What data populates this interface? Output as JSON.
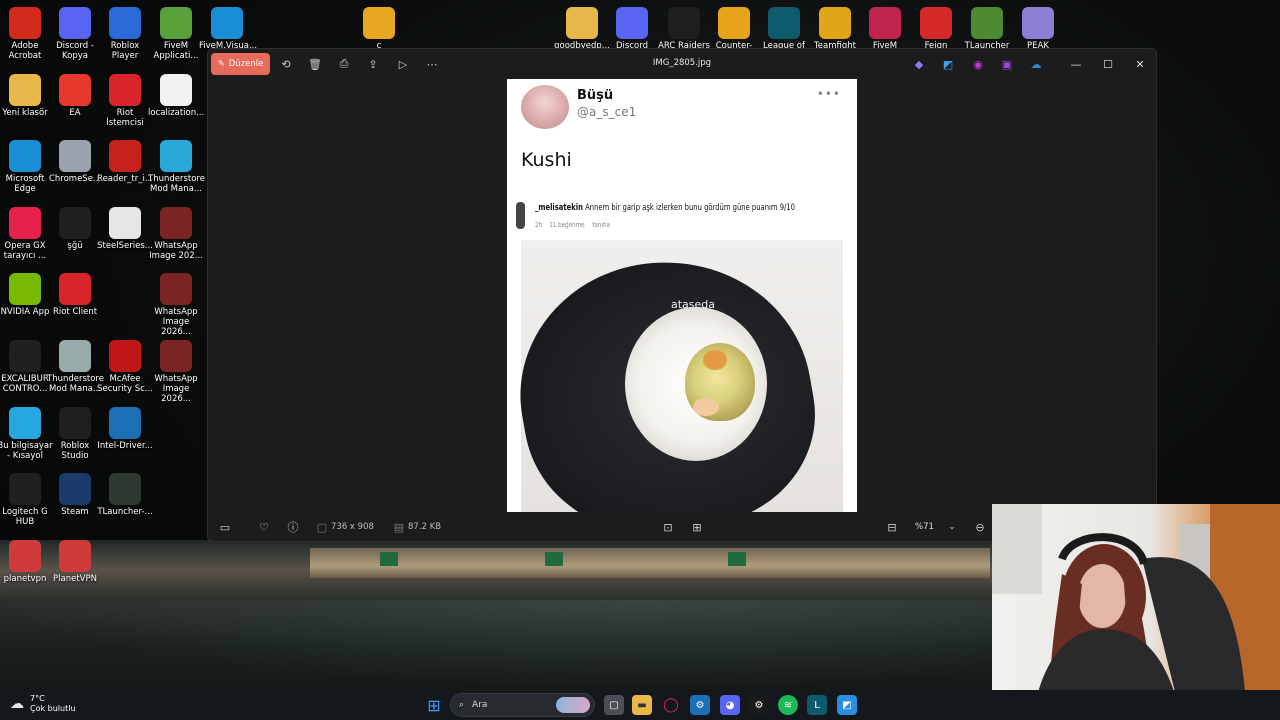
{
  "desktop": {
    "left_icons": [
      {
        "label": "Adobe\nAcrobat",
        "icon": "adobe-acrobat-icon",
        "color": "#d32a1c"
      },
      {
        "label": "Discord -\nKopya",
        "icon": "discord-icon",
        "color": "#5865f2"
      },
      {
        "label": "Roblox Player",
        "icon": "roblox-icon",
        "color": "#2a6ad8"
      },
      {
        "label": "FiveM\nApplicati...",
        "icon": "fivem-snail-icon",
        "color": "#58a03a"
      },
      {
        "label": "FiveM.Visua...",
        "icon": "edge-icon",
        "color": "#1b8fd6"
      },
      {
        "label": "Yeni klasör",
        "icon": "folder-icon",
        "color": "#e8b74a"
      },
      {
        "label": "EA",
        "icon": "ea-icon",
        "color": "#e6392b"
      },
      {
        "label": "Riot İstemcisi",
        "icon": "riot-icon",
        "color": "#d9252a"
      },
      {
        "label": "localization...",
        "icon": "file-icon",
        "color": "#f2f2f2"
      },
      {
        "label": "Microsoft\nEdge",
        "icon": "edge-icon",
        "color": "#1b8fd6"
      },
      {
        "label": "ChromeSe...",
        "icon": "chrome-setup-icon",
        "color": "#9aa3ad"
      },
      {
        "label": "Reader_tr_i...",
        "icon": "adobe-reader-icon",
        "color": "#c4221a"
      },
      {
        "label": "Thunderstore\nMod Mana...",
        "icon": "thunderstore-icon",
        "color": "#28a9d9"
      },
      {
        "label": "Opera GX\ntarayıcı ...",
        "icon": "opera-gx-icon",
        "color": "#e6214b"
      },
      {
        "label": "şğü",
        "icon": "epic-games-icon",
        "color": "#202020"
      },
      {
        "label": "SteelSeries...",
        "icon": "steelseries-icon",
        "color": "#e6e6e6"
      },
      {
        "label": "WhatsApp\nImage 202...",
        "icon": "image-thumb-icon",
        "color": "#7a2424"
      },
      {
        "label": "NVIDIA App",
        "icon": "nvidia-icon",
        "color": "#76b900"
      },
      {
        "label": "Riot Client",
        "icon": "riot-icon",
        "color": "#d9252a"
      },
      {
        "label": "WhatsApp\nImage 2026...",
        "icon": "image-thumb-icon",
        "color": "#7a2424"
      },
      {
        "label": "EXCALIBUR\nCONTRO...",
        "icon": "excalibur-icon",
        "color": "#202020"
      },
      {
        "label": "Thunderstore\nMod Mana...",
        "icon": "thunderstore-icon",
        "color": "#9aa"
      },
      {
        "label": "McAfee\nSecurity Sc...",
        "icon": "mcafee-icon",
        "color": "#c01818"
      },
      {
        "label": "WhatsApp\nImage 2026...",
        "icon": "image-thumb-icon",
        "color": "#7a2424"
      },
      {
        "label": "Bu bilgisayar\n- Kısayol",
        "icon": "this-pc-icon",
        "color": "#27a7e0"
      },
      {
        "label": "Roblox\nStudio",
        "icon": "roblox-studio-icon",
        "color": "#1f1f1f"
      },
      {
        "label": "Intel-Driver...",
        "icon": "intel-driver-icon",
        "color": "#1a6fb5"
      },
      {
        "label": "Logitech G\nHUB",
        "icon": "logitech-g-icon",
        "color": "#202020"
      },
      {
        "label": "Steam",
        "icon": "steam-icon",
        "color": "#1b3b6a"
      },
      {
        "label": "TLauncher-...",
        "icon": "tlauncher-icon",
        "color": "#2e3a30"
      },
      {
        "label": "planetvpn",
        "icon": "planetvpn-icon",
        "color": "#cf3a3a"
      },
      {
        "label": "PlanetVPN",
        "icon": "planetvpn-icon",
        "color": "#cf3a3a"
      }
    ],
    "top_icons": [
      {
        "label": "c",
        "icon": "chrome-icon",
        "color": "#e6a821"
      },
      {
        "label": "goodbyedp...",
        "icon": "folder-icon",
        "color": "#e8b74a"
      },
      {
        "label": "Discord",
        "icon": "discord-icon",
        "color": "#5865f2"
      },
      {
        "label": "ARC Raiders",
        "icon": "arc-raiders-icon",
        "color": "#1e1e1e"
      },
      {
        "label": "Counter-Str...",
        "icon": "counter-strike-icon",
        "color": "#e8a41c"
      },
      {
        "label": "League of",
        "icon": "league-icon",
        "color": "#0f5b6e"
      },
      {
        "label": "Teamfight",
        "icon": "teamfight-icon",
        "color": "#e0a618"
      },
      {
        "label": "FiveM",
        "icon": "fivem-icon",
        "color": "#c0234d"
      },
      {
        "label": "Feign",
        "icon": "feign-icon",
        "color": "#d62a2a"
      },
      {
        "label": "TLauncher",
        "icon": "minecraft-icon",
        "color": "#4d8a31"
      },
      {
        "label": "PEAK",
        "icon": "peak-icon",
        "color": "#8b7fd6"
      }
    ]
  },
  "viewer": {
    "edit_label": "Düzenle",
    "file_title": "IMG_2805.jpg",
    "dimensions": "736 x 908",
    "file_size": "87.2 KB",
    "zoom": "%71"
  },
  "post": {
    "display_name": "Büşü",
    "handle": "@a_s_ce1",
    "text": "Kushi",
    "ig_user": "_melisatekin",
    "ig_caption": "Annem bir garip aşk izlerken bunu gördüm  güne puanım 9/10",
    "ig_time": "2h",
    "ig_likes": "11 beğenme",
    "ig_reply": "Yanıtla",
    "watermark": "ataseda"
  },
  "taskbar": {
    "temperature": "7°C",
    "weather": "Çok bulutlu",
    "search_placeholder": "Ara"
  }
}
